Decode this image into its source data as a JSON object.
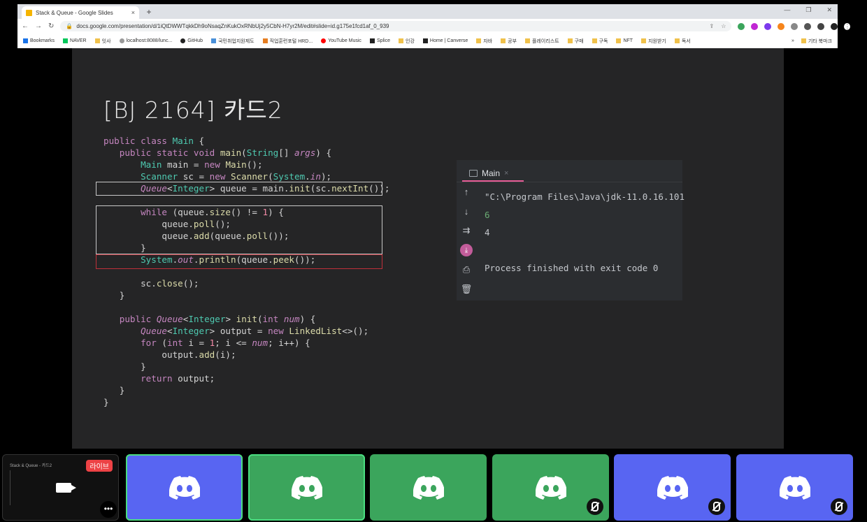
{
  "browser": {
    "tab_title": "Stack & Queue - Google Slides",
    "tab_close": "×",
    "new_tab": "+",
    "win_min": "—",
    "win_max": "❐",
    "win_close": "✕",
    "url": "docs.google.com/presentation/d/1iQtDWWTqkkDh9oNsaqZnKukOxRNbUj2y5CbN-H7yr2M/edit#slide=id.g175e1fcd1af_0_939",
    "back": "←",
    "forward": "→",
    "reload": "↻",
    "bookmarks": [
      "Bookmarks",
      "NAVER",
      "잇사",
      "localhost:8088/lunc...",
      "GitHub",
      "국민취업지원제도",
      "직업훈련포털 HRD...",
      "YouTube Music",
      "Splice",
      "인강",
      "Home | Canverse",
      "자바",
      "공부",
      "플레이리스트",
      "구매",
      "구독",
      "NFT",
      "지원받기",
      "독서"
    ],
    "bookmarks_more": "»",
    "other_bookmarks": "기타 북마크"
  },
  "slide": {
    "title": "[BJ 2164] 카드2"
  },
  "run_panel": {
    "tab_label": "Main",
    "tab_close": "×",
    "toolbar_icons": [
      "up-arrow-icon",
      "down-arrow-icon",
      "soft-wrap-icon",
      "scroll-to-end-icon",
      "print-icon",
      "trash-icon"
    ],
    "output_cmd": "\"C:\\Program Files\\Java\\jdk-11.0.16.101",
    "output_1": "6",
    "output_2": "4",
    "output_finish": "Process finished with exit code 0"
  },
  "participants": {
    "live_badge": "라이브",
    "thumb_caption": "Stack & Queue - 카드2",
    "more": "•••",
    "tiles": [
      {
        "color": "blue",
        "speaking": true,
        "muted": false
      },
      {
        "color": "green",
        "speaking": true,
        "muted": false
      },
      {
        "color": "green",
        "speaking": false,
        "muted": false
      },
      {
        "color": "green",
        "speaking": false,
        "muted": true
      },
      {
        "color": "blue",
        "speaking": false,
        "muted": true
      },
      {
        "color": "blue",
        "speaking": false,
        "muted": true
      }
    ]
  },
  "colors": {
    "discord_blue": "#5865f2",
    "discord_green": "#3ba55c",
    "live_red": "#ed4245",
    "highlight_red": "#c0303a"
  }
}
